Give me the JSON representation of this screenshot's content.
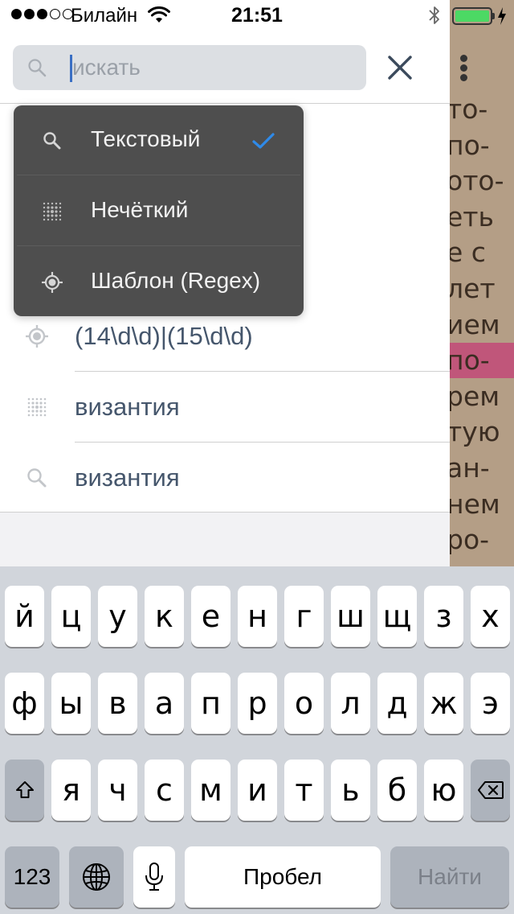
{
  "status_bar": {
    "carrier": "Билайн",
    "time": "21:51",
    "signal_bars_filled": 3,
    "signal_bars_total": 5,
    "battery_level": 1.0,
    "battery_color": "#4cd964",
    "icons": [
      "wifi-icon",
      "bluetooth-icon",
      "battery-icon",
      "charging-bolt-icon"
    ]
  },
  "search": {
    "placeholder": "искать",
    "value": "",
    "icon": "search-icon",
    "close_icon": "close-icon",
    "more_icon": "more-vertical-icon",
    "caret_color": "#3a6fc4"
  },
  "search_mode_menu": {
    "items": [
      {
        "label": "Текстовый",
        "icon": "search-icon",
        "selected": true
      },
      {
        "label": "Нечёткий",
        "icon": "fuzzy-dots-icon",
        "selected": false
      },
      {
        "label": "Шаблон (Regex)",
        "icon": "regex-target-icon",
        "selected": false
      }
    ],
    "check_color": "#2f8ae8"
  },
  "history": [
    {
      "text": "(14\\d\\d)|(15\\d\\d)",
      "icon": "regex-target-icon"
    },
    {
      "text": "византия",
      "icon": "fuzzy-dots-icon"
    },
    {
      "text": "византия",
      "icon": "search-icon"
    }
  ],
  "book_text": {
    "lines": [
      "то-",
      "по-",
      "ото-",
      "еть",
      "е с",
      "лет",
      "ием",
      "по-",
      "рем",
      "тую",
      "ан-",
      "нем",
      "ро-"
    ],
    "highlight_color": "#c0567a",
    "highlight_line": 7
  },
  "keyboard": {
    "row1": [
      "й",
      "ц",
      "у",
      "к",
      "е",
      "н",
      "г",
      "ш",
      "щ",
      "з",
      "х"
    ],
    "row2": [
      "ф",
      "ы",
      "в",
      "а",
      "п",
      "р",
      "о",
      "л",
      "д",
      "ж",
      "э"
    ],
    "row3": [
      "я",
      "ч",
      "с",
      "м",
      "и",
      "т",
      "ь",
      "б",
      "ю"
    ],
    "numbers_key": "123",
    "space_key": "Пробел",
    "return_key": "Найти",
    "icons": [
      "shift-icon",
      "backspace-icon",
      "globe-icon",
      "microphone-icon"
    ]
  }
}
